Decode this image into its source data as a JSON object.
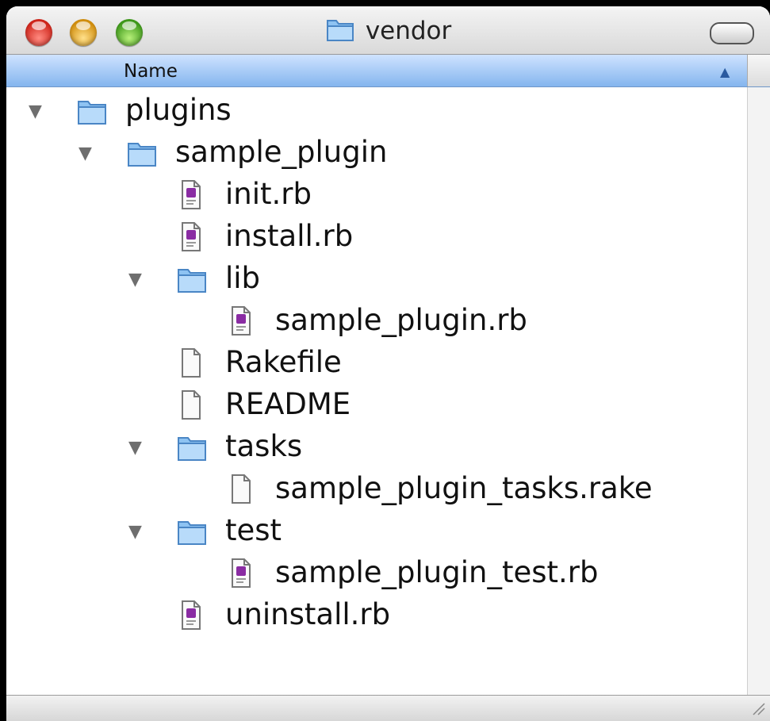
{
  "window": {
    "title": "vendor"
  },
  "header": {
    "name_label": "Name"
  },
  "tree": [
    {
      "label": "plugins",
      "type": "folder",
      "depth": 0,
      "expanded": true
    },
    {
      "label": "sample_plugin",
      "type": "folder",
      "depth": 1,
      "expanded": true
    },
    {
      "label": "init.rb",
      "type": "ruby",
      "depth": 2
    },
    {
      "label": "install.rb",
      "type": "ruby",
      "depth": 2
    },
    {
      "label": "lib",
      "type": "folder",
      "depth": 2,
      "expanded": true
    },
    {
      "label": "sample_plugin.rb",
      "type": "ruby",
      "depth": 3
    },
    {
      "label": "Rakefile",
      "type": "document",
      "depth": 2
    },
    {
      "label": "README",
      "type": "document",
      "depth": 2
    },
    {
      "label": "tasks",
      "type": "folder",
      "depth": 2,
      "expanded": true
    },
    {
      "label": "sample_plugin_tasks.rake",
      "type": "document",
      "depth": 3
    },
    {
      "label": "test",
      "type": "folder",
      "depth": 2,
      "expanded": true
    },
    {
      "label": "sample_plugin_test.rb",
      "type": "ruby",
      "depth": 3
    },
    {
      "label": "uninstall.rb",
      "type": "ruby",
      "depth": 2
    }
  ],
  "icons": {
    "folder": "folder-icon",
    "ruby": "ruby-file-icon",
    "document": "document-icon",
    "disclosure": "disclosure-triangle-down-icon"
  },
  "colors": {
    "header_top": "#cfe3ff",
    "header_bottom": "#84b5ee",
    "folder_blue": "#8ec3f2",
    "ruby_purple": "#8a2ca3"
  }
}
